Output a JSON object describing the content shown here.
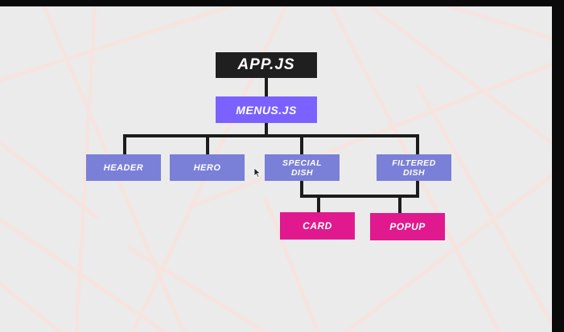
{
  "colors": {
    "root": "#1f1f1f",
    "parent": "#7b61ff",
    "child": "#7a7fd8",
    "grandchild": "#e0198f",
    "connector": "#1c1c1c",
    "background": "#ebebeb",
    "background_lines": "#f6e4e0"
  },
  "nodes": {
    "app": {
      "label": "APP.JS"
    },
    "menus": {
      "label": "MENUS.JS"
    },
    "header": {
      "label": "HEADER"
    },
    "hero": {
      "label": "HERO"
    },
    "special": {
      "line1": "SPECIAL",
      "line2": "DISH"
    },
    "filtered": {
      "line1": "FILTERED",
      "line2": "DISH"
    },
    "card": {
      "label": "CARD"
    },
    "popup": {
      "label": "POPUP"
    }
  },
  "edges": [
    [
      "app",
      "menus"
    ],
    [
      "menus",
      "header"
    ],
    [
      "menus",
      "hero"
    ],
    [
      "menus",
      "special"
    ],
    [
      "menus",
      "filtered"
    ],
    [
      "special",
      "card"
    ],
    [
      "filtered",
      "popup"
    ]
  ],
  "icons": {
    "cursor": "mouse-pointer-icon"
  }
}
